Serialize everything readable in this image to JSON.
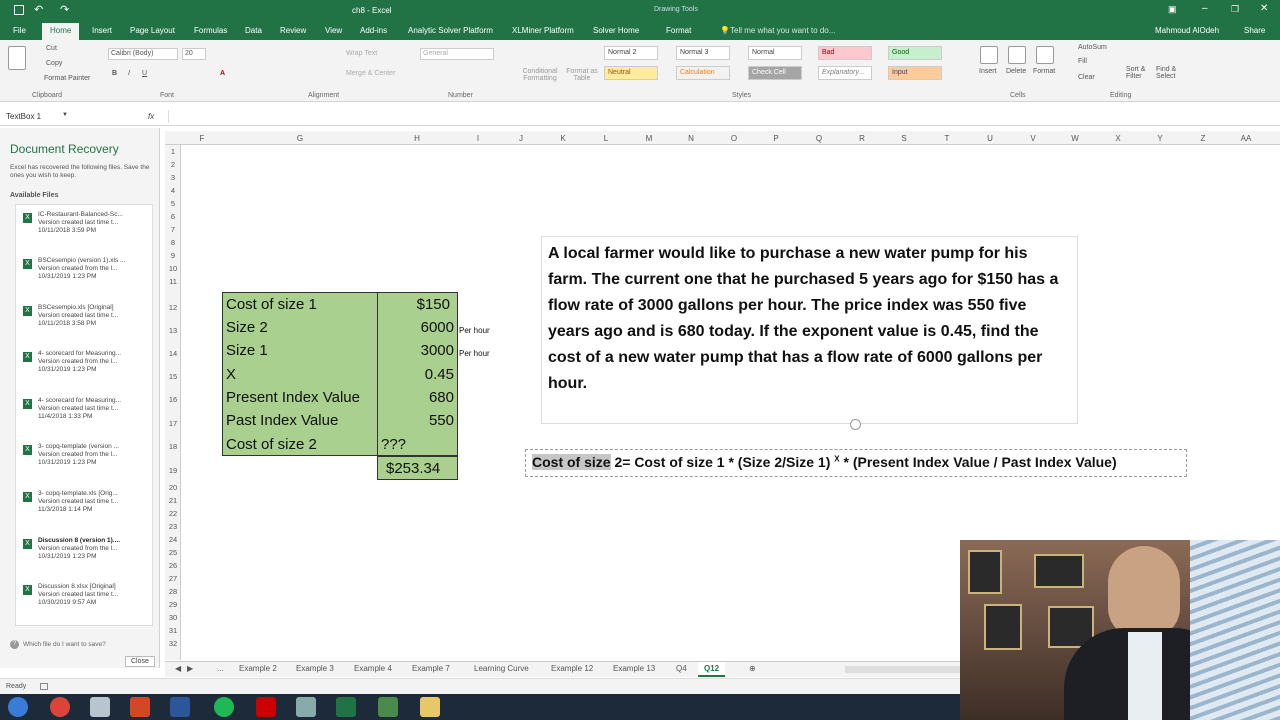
{
  "app": {
    "title": "ch8 - Excel",
    "drawing_tools": "Drawing Tools",
    "user": "Mahmoud AlOdeh",
    "share": "Share",
    "tell_me": "Tell me what you want to do..."
  },
  "ribbon_tabs": [
    "File",
    "Home",
    "Insert",
    "Page Layout",
    "Formulas",
    "Data",
    "Review",
    "View",
    "Add-ins",
    "Analytic Solver Platform",
    "XLMiner Platform",
    "Solver Home",
    "Format"
  ],
  "ribbon": {
    "cut": "Cut",
    "copy": "Copy",
    "format_painter": "Format Painter",
    "clipboard": "Clipboard",
    "font_name": "Calibri (Body)",
    "font_size": "20",
    "font": "Font",
    "alignment": "Alignment",
    "wrap_text": "Wrap Text",
    "merge_center": "Merge & Center",
    "number_format": "General",
    "number": "Number",
    "conditional_formatting": "Conditional Formatting",
    "format_as_table": "Format as Table",
    "styles": [
      "Normal 2",
      "Normal 3",
      "Normal",
      "Bad",
      "Good",
      "Neutral",
      "Calculation",
      "Check Cell",
      "Explanatory...",
      "Input"
    ],
    "styles_label": "Styles",
    "insert": "Insert",
    "delete": "Delete",
    "format": "Format",
    "cells": "Cells",
    "autosum": "AutoSum",
    "fill": "Fill",
    "clear": "Clear",
    "sort_filter": "Sort & Filter",
    "find_select": "Find & Select",
    "editing": "Editing"
  },
  "formula_bar": {
    "name_box": "TextBox 1",
    "fx": "fx"
  },
  "recovery": {
    "title": "Document Recovery",
    "desc": "Excel has recovered the following files. Save the ones you wish to keep.",
    "available": "Available Files",
    "files": [
      {
        "name": "IC-Restaurant-Balanced-Sc...",
        "line2": "Version created last time t...",
        "date": "10/11/2018 3:59 PM"
      },
      {
        "name": "BSCesempio (version 1).xls ...",
        "line2": "Version created from the l...",
        "date": "10/31/2019 1:23 PM"
      },
      {
        "name": "BSCesempio.xls [Original]",
        "line2": "Version created last time t...",
        "date": "10/11/2018 3:58 PM"
      },
      {
        "name": "4- scorecard for Measuring...",
        "line2": "Version created from the l...",
        "date": "10/31/2019 1:23 PM"
      },
      {
        "name": "4- scorecard for Measuring...",
        "line2": "Version created last time t...",
        "date": "11/4/2018 1:33 PM"
      },
      {
        "name": "3- copq-template (version ...",
        "line2": "Version created from the l...",
        "date": "10/31/2019 1:23 PM"
      },
      {
        "name": "3- copq-template.xls [Orig...",
        "line2": "Version created last time t...",
        "date": "11/3/2018 1:14 PM"
      },
      {
        "name": "Discussion 8 (version 1)....",
        "line2": "Version created from the l...",
        "date": "10/31/2019 1:23 PM"
      },
      {
        "name": "Discussion 8.xlsx [Original]",
        "line2": "Version created last time t...",
        "date": "10/30/2019 9:57 AM"
      }
    ],
    "which": "Which file do I want to save?",
    "close": "Close"
  },
  "columns": [
    "F",
    "G",
    "H",
    "I",
    "J",
    "K",
    "L",
    "M",
    "N",
    "O",
    "P",
    "Q",
    "R",
    "S",
    "T",
    "U",
    "V",
    "W",
    "X",
    "Y",
    "Z",
    "AA"
  ],
  "rows": [
    "1",
    "2",
    "3",
    "4",
    "5",
    "6",
    "7",
    "8",
    "9",
    "10",
    "11",
    "12",
    "13",
    "14",
    "15",
    "16",
    "17",
    "18",
    "19",
    "20",
    "21",
    "22",
    "23",
    "24",
    "25",
    "26",
    "27",
    "28",
    "29",
    "30",
    "31",
    "32"
  ],
  "table": {
    "labels": [
      "Cost of size 1",
      "Size 2",
      "Size 1",
      "X",
      "Present Index Value",
      "Past Index Value",
      "Cost of size 2"
    ],
    "values": [
      "$150",
      "6000",
      "3000",
      "0.45",
      "680",
      "550",
      "???"
    ],
    "result": "$253.34",
    "per_hour": "Per hour"
  },
  "problem": "A local farmer would like to purchase a new water pump for his farm. The current one that he purchased 5 years ago for $150 has a flow rate of 3000 gallons per hour. The price index was 550 five years ago and is 680 today. If the exponent value is 0.45, find the cost of a new water pump that has a flow rate of 6000 gallons per hour.",
  "formula": {
    "selected": "Cost of size",
    "rest": " 2= Cost of size 1 * (Size 2/Size 1) ",
    "sup": "X",
    "tail": " * (Present Index Value / Past Index Value)"
  },
  "sheet_tabs": [
    "...",
    "Example 2",
    "Example 3",
    "Example 4",
    "Example 7",
    "Learning Curve",
    "Example 12",
    "Example 13",
    "Q4",
    "Q12"
  ],
  "active_sheet": "Q12",
  "status": "Ready"
}
